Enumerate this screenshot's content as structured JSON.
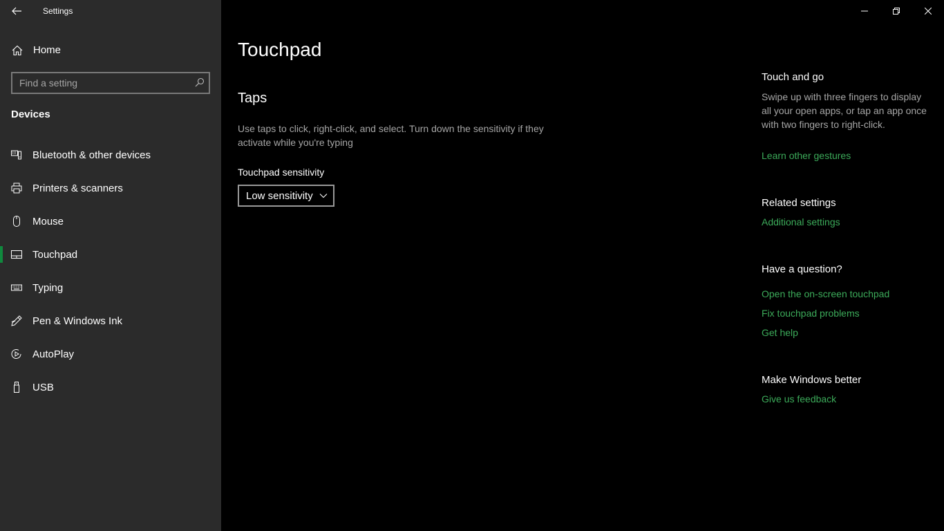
{
  "window": {
    "title": "Settings"
  },
  "sidebar": {
    "home_label": "Home",
    "search_placeholder": "Find a setting",
    "section": "Devices",
    "items": [
      {
        "label": "Bluetooth & other devices",
        "icon": "bluetooth-devices-icon"
      },
      {
        "label": "Printers & scanners",
        "icon": "printer-icon"
      },
      {
        "label": "Mouse",
        "icon": "mouse-icon"
      },
      {
        "label": "Touchpad",
        "icon": "touchpad-icon",
        "active": true
      },
      {
        "label": "Typing",
        "icon": "keyboard-icon"
      },
      {
        "label": "Pen & Windows Ink",
        "icon": "pen-icon"
      },
      {
        "label": "AutoPlay",
        "icon": "autoplay-icon"
      },
      {
        "label": "USB",
        "icon": "usb-icon"
      }
    ]
  },
  "main": {
    "title": "Touchpad",
    "taps_heading": "Taps",
    "taps_description": "Use taps to click, right-click, and select. Turn down the sensitivity if they activate while you're typing",
    "sensitivity_label": "Touchpad sensitivity",
    "sensitivity_value": "Low sensitivity"
  },
  "side": {
    "touch_heading": "Touch and go",
    "touch_text": "Swipe up with three fingers to display all your open apps, or tap an app once with two fingers to right-click.",
    "learn_link": "Learn other gestures",
    "related_heading": "Related settings",
    "additional_link": "Additional settings",
    "question_heading": "Have a question?",
    "q_links": [
      "Open the on-screen touchpad",
      "Fix touchpad problems",
      "Get help"
    ],
    "better_heading": "Make Windows better",
    "feedback_link": "Give us feedback"
  },
  "colors": {
    "accent": "#10893e",
    "link": "#3cab5a",
    "sidebar_bg": "#2b2b2b",
    "main_bg": "#000000"
  }
}
